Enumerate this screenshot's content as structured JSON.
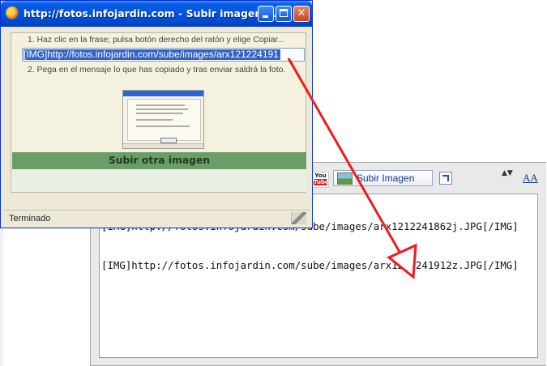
{
  "window": {
    "title": "http://fotos.infojardin.com - Subir imagen ...",
    "controls": {
      "minimize": "_",
      "maximize": "□",
      "close": "✕"
    }
  },
  "popup": {
    "step1": "1. Haz clic en la frase; pulsa botón derecho del ratón y elige Copiar...",
    "url_value": "[IMG]http://fotos.infojardin.com/sube/images/arx121224191",
    "step2": "2. Pega en el mensaje lo que has copiado y tras enviar saldrá la foto.",
    "subir_otra_label": "Subir otra imagen"
  },
  "statusbar": {
    "text": "Terminado"
  },
  "editor": {
    "toolbar": {
      "youtube_icon_top": "You",
      "youtube_icon_bottom": "Tube",
      "subir_imagen_label": "Subir Imagen",
      "updown_glyph": "▲▼",
      "fontsize_glyph": "AA"
    },
    "text_lines": [
      "[IMG]http://fotos.infojardin.com/sube/images/arx1212241862j.JPG[/IMG]",
      "[IMG]http://fotos.infojardin.com/sube/images/arx1212241912z.JPG[/IMG]"
    ]
  },
  "colors": {
    "xp_title_blue": "#0054e3",
    "selection_blue": "#3163c5",
    "green_button": "#6a9d68",
    "arrow_red": "#ee1c1c"
  }
}
